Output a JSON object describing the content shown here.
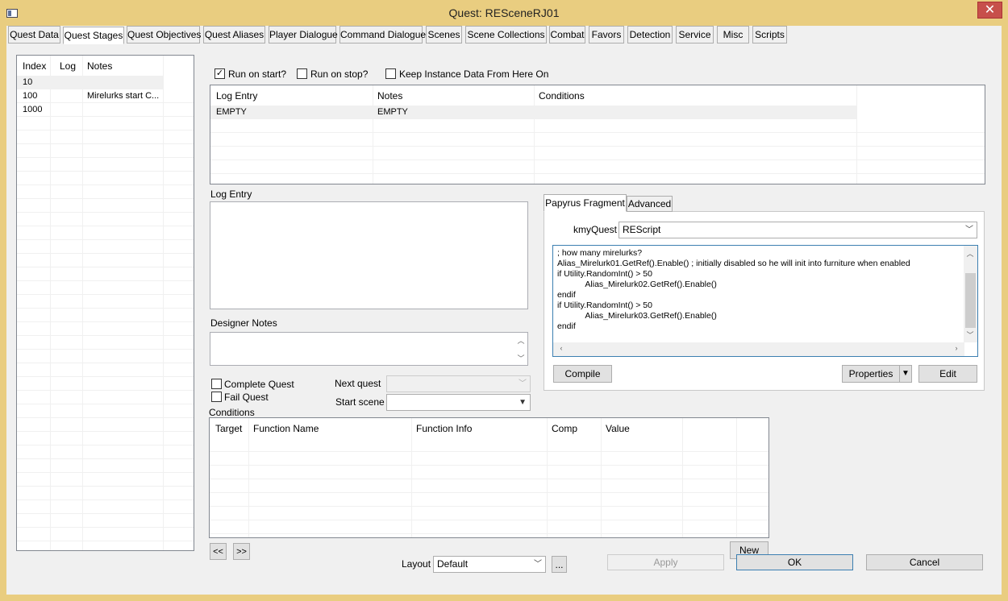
{
  "window": {
    "title": "Quest: RESceneRJ01",
    "close_glyph": "✕"
  },
  "tabs": [
    {
      "label": "Quest Data"
    },
    {
      "label": "Quest Stages"
    },
    {
      "label": "Quest Objectives"
    },
    {
      "label": "Quest Aliases"
    },
    {
      "label": "Player Dialogue"
    },
    {
      "label": "Command Dialogue"
    },
    {
      "label": "Scenes"
    },
    {
      "label": "Scene Collections"
    },
    {
      "label": "Combat"
    },
    {
      "label": "Favors"
    },
    {
      "label": "Detection"
    },
    {
      "label": "Service"
    },
    {
      "label": "Misc"
    },
    {
      "label": "Scripts"
    }
  ],
  "active_tab": "Quest Stages",
  "stages": {
    "headers": {
      "index": "Index",
      "log": "Log",
      "notes": "Notes"
    },
    "rows": [
      {
        "index": "10",
        "log": "",
        "notes": ""
      },
      {
        "index": "100",
        "log": "",
        "notes": "Mirelurks start C..."
      },
      {
        "index": "1000",
        "log": "",
        "notes": ""
      }
    ]
  },
  "options": {
    "run_on_start": {
      "label": "Run on start?",
      "checked": true
    },
    "run_on_stop": {
      "label": "Run on stop?",
      "checked": false
    },
    "keep_instance": {
      "label": "Keep Instance Data From Here On",
      "checked": false
    }
  },
  "log_table": {
    "headers": {
      "log_entry": "Log Entry",
      "notes": "Notes",
      "conditions": "Conditions"
    },
    "rows": [
      {
        "log_entry": "EMPTY",
        "notes": "EMPTY",
        "conditions": ""
      }
    ]
  },
  "log_entry_label": "Log Entry",
  "designer_notes_label": "Designer Notes",
  "complete_quest": {
    "label": "Complete Quest",
    "checked": false
  },
  "fail_quest": {
    "label": "Fail Quest",
    "checked": false
  },
  "next_quest_label": "Next quest",
  "start_scene_label": "Start scene",
  "fragment": {
    "tabs": {
      "papyrus": "Papyrus Fragment",
      "advanced": "Advanced"
    },
    "kmyquest_label": "kmyQuest",
    "kmyquest_value": "REScript",
    "code_lines": [
      "; how many mirelurks?",
      "Alias_Mirelurk01.GetRef().Enable() ; initially disabled so he will init into furniture when enabled",
      "if Utility.RandomInt() > 50",
      "            Alias_Mirelurk02.GetRef().Enable()",
      "endif",
      "if Utility.RandomInt() > 50",
      "            Alias_Mirelurk03.GetRef().Enable()",
      "endif"
    ],
    "compile": "Compile",
    "properties": "Properties",
    "edit": "Edit"
  },
  "conditions": {
    "label": "Conditions",
    "headers": {
      "target": "Target",
      "function_name": "Function Name",
      "function_info": "Function Info",
      "comp": "Comp",
      "value": "Value"
    }
  },
  "nav": {
    "prev": "<<",
    "next": ">>"
  },
  "new_button": "New",
  "layout": {
    "label": "Layout",
    "value": "Default",
    "more": "..."
  },
  "buttons": {
    "apply": "Apply",
    "ok": "OK",
    "cancel": "Cancel"
  },
  "colors": {
    "titlebar": "#e9cd80",
    "close": "#c7504b",
    "face": "#f0f0f0",
    "focus": "#3c7fb1"
  }
}
